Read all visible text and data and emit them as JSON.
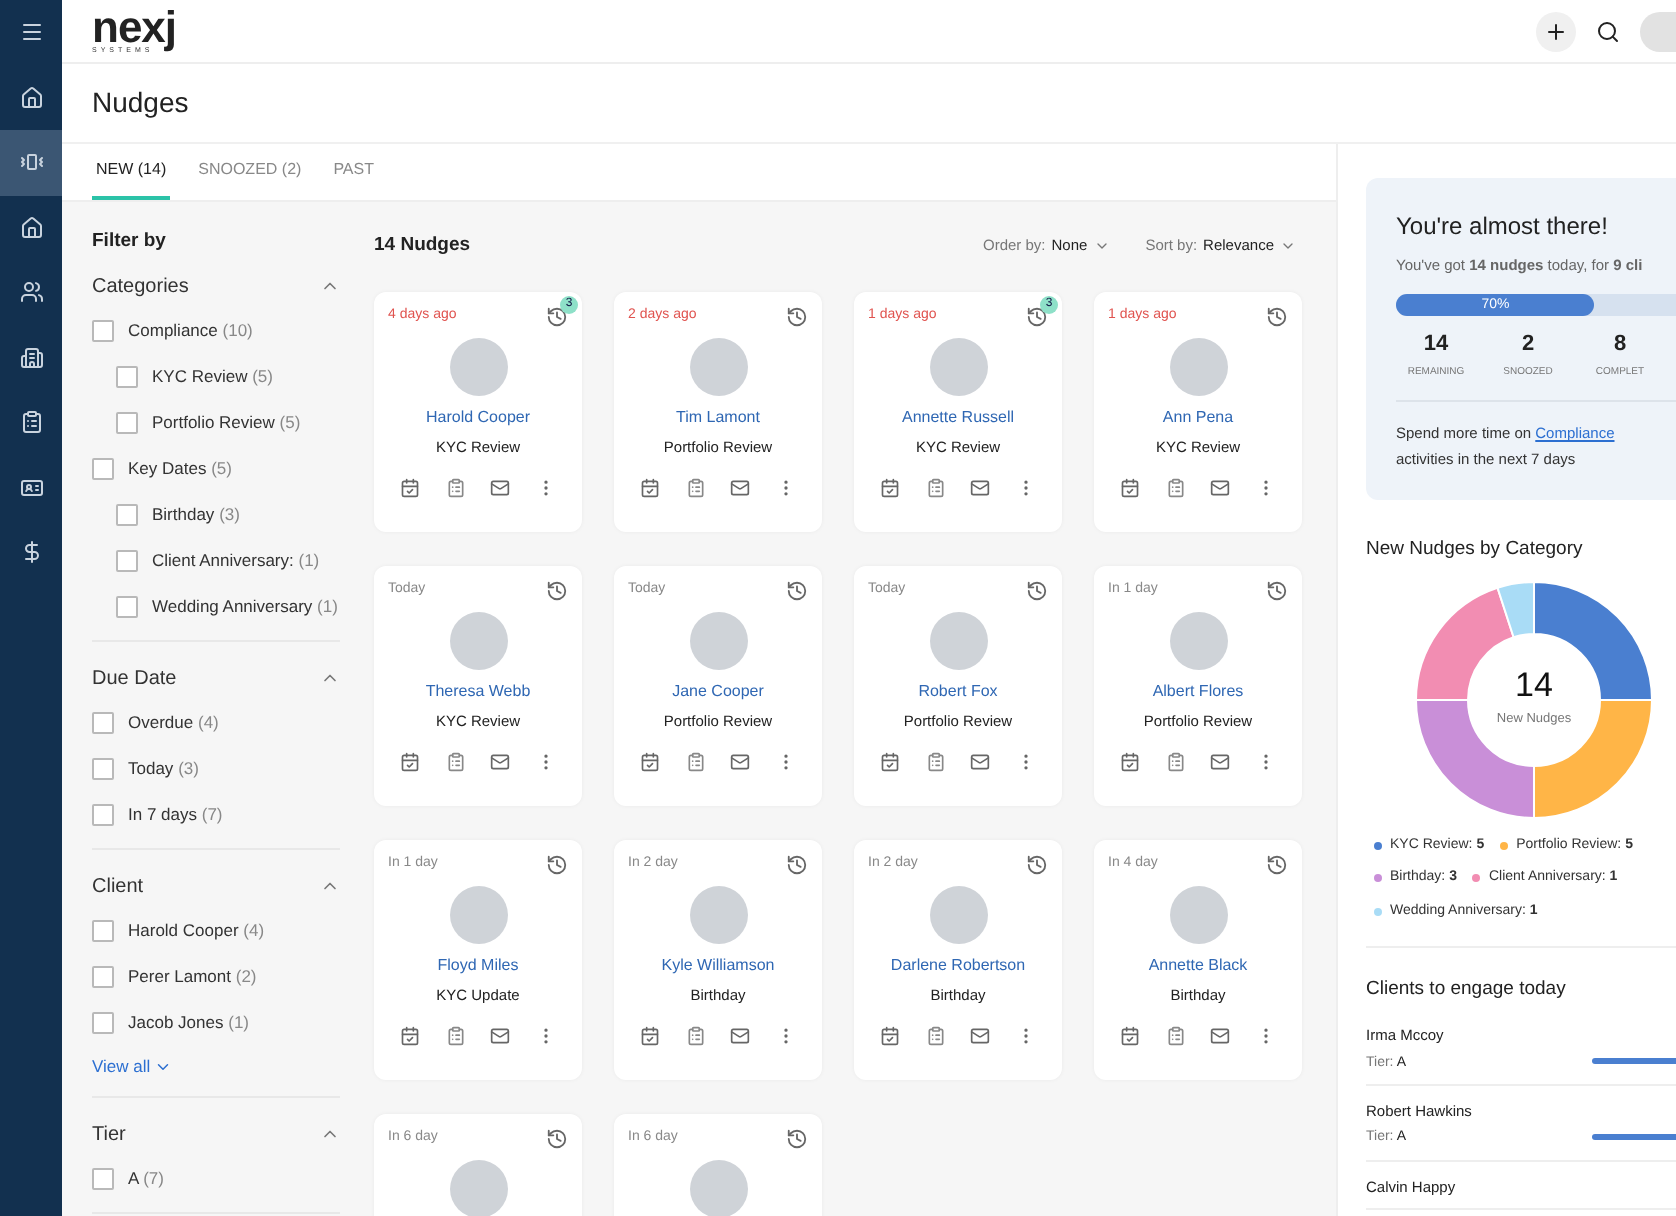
{
  "nav": [
    {
      "selected": false
    },
    {
      "selected": false
    },
    {
      "selected": true
    },
    {
      "selected": false
    },
    {
      "selected": false
    },
    {
      "selected": false
    },
    {
      "selected": false
    },
    {
      "selected": false
    },
    {
      "selected": false
    }
  ],
  "logo": {
    "name": "nexj",
    "tagline": "SYSTEMS"
  },
  "page_title": "Nudges",
  "tabs": [
    {
      "label": "NEW (14)",
      "selected": true
    },
    {
      "label": "SNOOZED (2)",
      "selected": false
    },
    {
      "label": "PAST",
      "selected": false
    }
  ],
  "filter": {
    "title": "Filter by",
    "sections": [
      {
        "title": "Categories",
        "expanded": true,
        "items": [
          {
            "label": "Compliance",
            "count": "(10)",
            "checked": false,
            "children": [
              {
                "label": "KYC Review",
                "count": "(5)",
                "checked": false
              },
              {
                "label": "Portfolio Review",
                "count": "(5)",
                "checked": false
              }
            ]
          },
          {
            "label": "Key Dates",
            "count": "(5)",
            "checked": false,
            "children": [
              {
                "label": "Birthday",
                "count": "(3)",
                "checked": false
              },
              {
                "label": "Client Anniversary:",
                "count": "(1)",
                "checked": false
              },
              {
                "label": "Wedding Anniversary",
                "count": "(1)",
                "checked": false
              }
            ]
          }
        ]
      },
      {
        "title": "Due Date",
        "expanded": true,
        "items": [
          {
            "label": "Overdue",
            "count": "(4)",
            "checked": false
          },
          {
            "label": "Today",
            "count": "(3)",
            "checked": false
          },
          {
            "label": "In 7 days",
            "count": "(7)",
            "checked": false
          }
        ]
      },
      {
        "title": "Client",
        "expanded": true,
        "items": [
          {
            "label": "Harold Cooper",
            "count": "(4)",
            "checked": false
          },
          {
            "label": "Perer Lamont",
            "count": "(2)",
            "checked": false
          },
          {
            "label": "Jacob Jones",
            "count": "(1)",
            "checked": false
          }
        ],
        "view_all": "View all"
      },
      {
        "title": "Tier",
        "expanded": true,
        "items": [
          {
            "label": "A",
            "count": "(7)",
            "checked": false
          }
        ]
      }
    ]
  },
  "nudges": {
    "count_label": "14 Nudges",
    "order": {
      "label": "Order by:",
      "value": "None"
    },
    "sort": {
      "label": "Sort by:",
      "value": "Relevance"
    },
    "cards": [
      {
        "due": "4 days ago",
        "overdue": true,
        "badge": "3",
        "name": "Harold Cooper",
        "category": "KYC Review"
      },
      {
        "due": "2 days ago",
        "overdue": true,
        "name": "Tim Lamont",
        "category": "Portfolio Review"
      },
      {
        "due": "1 days ago",
        "overdue": true,
        "badge": "3",
        "name": "Annette Russell",
        "category": "KYC Review"
      },
      {
        "due": "1 days ago",
        "overdue": true,
        "name": "Ann Pena",
        "category": "KYC Review"
      },
      {
        "due": "Today",
        "overdue": false,
        "name": "Theresa Webb",
        "category": "KYC Review"
      },
      {
        "due": "Today",
        "overdue": false,
        "name": "Jane Cooper",
        "category": "Portfolio Review"
      },
      {
        "due": "Today",
        "overdue": false,
        "name": "Robert Fox",
        "category": "Portfolio Review"
      },
      {
        "due": "In 1 day",
        "overdue": false,
        "name": "Albert Flores",
        "category": "Portfolio Review"
      },
      {
        "due": "In 1 day",
        "overdue": false,
        "name": "Floyd Miles",
        "category": "KYC Update"
      },
      {
        "due": "In 2 day",
        "overdue": false,
        "name": "Kyle Williamson",
        "category": "Birthday"
      },
      {
        "due": "In 2 day",
        "overdue": false,
        "name": "Darlene Robertson",
        "category": "Birthday"
      },
      {
        "due": "In 4 day",
        "overdue": false,
        "name": "Annette Black",
        "category": "Birthday"
      },
      {
        "due": "In 6 day",
        "overdue": false
      },
      {
        "due": "In 6 day",
        "overdue": false
      }
    ]
  },
  "summary": {
    "title": "You're almost there!",
    "text": "You've got **14 nudges** today, for **9 cli**",
    "level": 0.7,
    "percent": "70%",
    "stats": [
      {
        "value": "14",
        "label": "REMAINING"
      },
      {
        "value": "2",
        "label": "SNOOZED"
      },
      {
        "value": "8",
        "label": "COMPLET"
      }
    ],
    "tip": {
      "before": "Spend more time on",
      "link": "Compliance",
      "after": "activities in the next 7 days"
    }
  },
  "by_category": {
    "title": "New Nudges by Category",
    "center_value": "14",
    "center_label": "New Nudges",
    "chart_data": {
      "type": "donut",
      "values": [
        25,
        25,
        25,
        20,
        5
      ]
    },
    "legend": [
      {
        "label": "KYC Review:",
        "value": "5",
        "color": "#4a7fd0"
      },
      {
        "label": "Portfolio Review:",
        "value": "5",
        "color": "#ffb547"
      },
      {
        "label": "Birthday:",
        "value": "3",
        "color": "#c98fd8"
      },
      {
        "label": "Client Anniversary:",
        "value": "1",
        "color": "#f28db2"
      },
      {
        "label": "Wedding Anniversary:",
        "value": "1",
        "color": "#a9dcf6"
      }
    ]
  },
  "clients": {
    "title": "Clients to engage today",
    "items": [
      {
        "name": "Irma Mccoy",
        "tier_label": "Tier:",
        "tier": "A"
      },
      {
        "name": "Robert Hawkins",
        "tier_label": "Tier:",
        "tier": "A"
      },
      {
        "name": "Calvin Happy"
      }
    ]
  }
}
